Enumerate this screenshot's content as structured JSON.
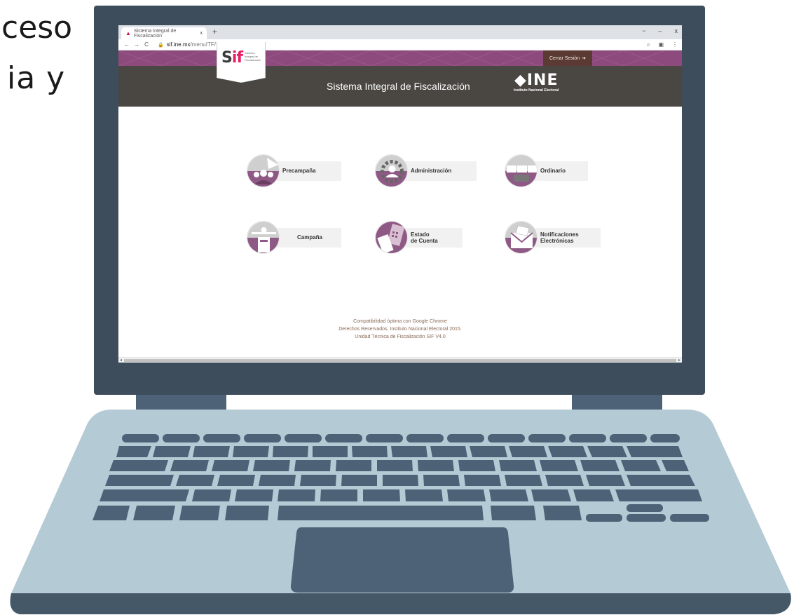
{
  "background_text": {
    "line1": "ceso",
    "line2": "ia  y"
  },
  "browser": {
    "tab_title": "Sistema Integral de Fiscalización",
    "tab_close": "x",
    "new_tab": "+",
    "url_host": "sif.ine.mx",
    "url_path": "/menuITF/",
    "window_controls": [
      "−",
      "–",
      "x"
    ]
  },
  "header": {
    "logout_label": "Cerrar Sesión",
    "logo_sub": [
      "Sistema",
      "Integral de",
      "Fiscalización"
    ],
    "system_title": "Sistema Integral de Fiscalización",
    "ine_big": "INE",
    "ine_small": "Instituto Nacional Electoral"
  },
  "menu": {
    "precampana": "Precampaña",
    "administracion": "Administración",
    "ordinario": "Ordinario",
    "campana": "Campaña",
    "estado_cuenta": [
      "Estado",
      "de Cuenta"
    ],
    "notificaciones": [
      "Notificaciones",
      "Electrónicas"
    ]
  },
  "footer": {
    "line1": "Compatibilidad óptima con Google Chrome",
    "line2": "Derechos Reservados, Instituto Nacional Electoral 2015.",
    "line3": "Unidad Técnica de Fiscalización SIF V4.0"
  },
  "colors": {
    "banner": "#8d4a7c",
    "header": "#4a4742",
    "accent": "#e91e63",
    "icon_purple": "#8e5a85",
    "laptop_dark": "#3d4d5c",
    "laptop_light": "#b4cad5"
  }
}
